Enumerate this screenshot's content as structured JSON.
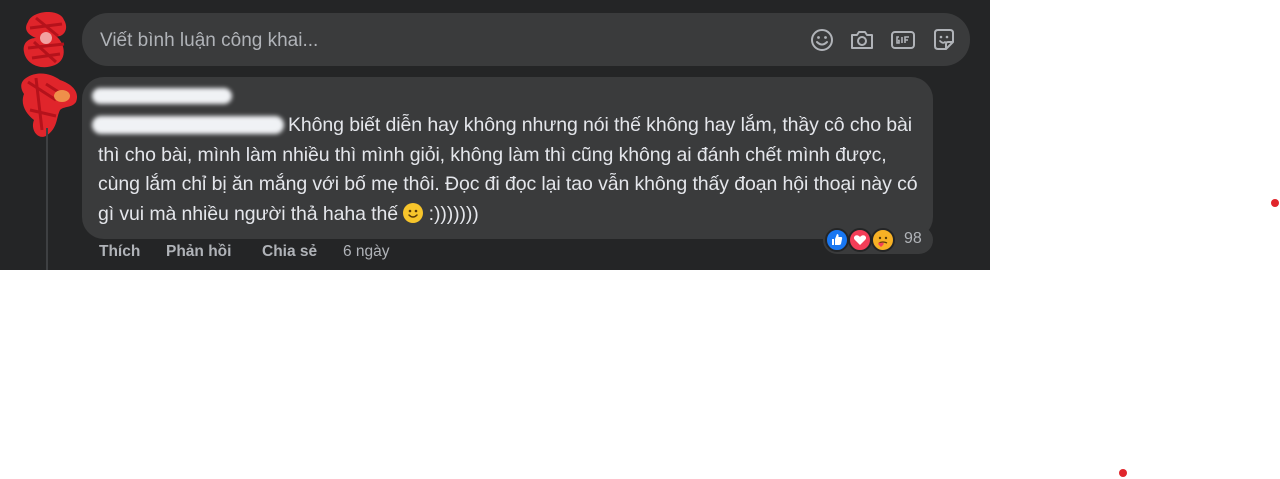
{
  "comment_box": {
    "placeholder": "Viết bình luận công khai...",
    "icons": [
      "smiley-icon",
      "camera-icon",
      "gif-icon",
      "sticker-icon"
    ]
  },
  "comment": {
    "text": "Không biết diễn hay không nhưng nói thế không hay lắm, thầy cô cho bài thì cho bài, mình làm nhiều thì mình giỏi, không làm thì cũng không ai đánh chết mình được, cùng lắm chỉ bị ăn mắng với bố mẹ thôi. Đọc đi đọc lại tao vẫn không thấy đoạn hội thoại này có gì vui mà nhiều người thả haha thế",
    "suffix": " :)))))))",
    "reactions": {
      "types": [
        "like",
        "love",
        "care"
      ],
      "count": "98"
    }
  },
  "actions": {
    "like": "Thích",
    "reply": "Phản hồi",
    "share": "Chia sẻ",
    "time": "6 ngày"
  },
  "colors": {
    "panel_bg": "#242526",
    "bubble_bg": "#3a3b3c",
    "text_primary": "#e4e6eb",
    "text_secondary": "#b0b3b8",
    "like_blue": "#1877f2",
    "love_red": "#f33e58",
    "care_yellow": "#f7b125",
    "annotation_red": "#e0252b"
  }
}
